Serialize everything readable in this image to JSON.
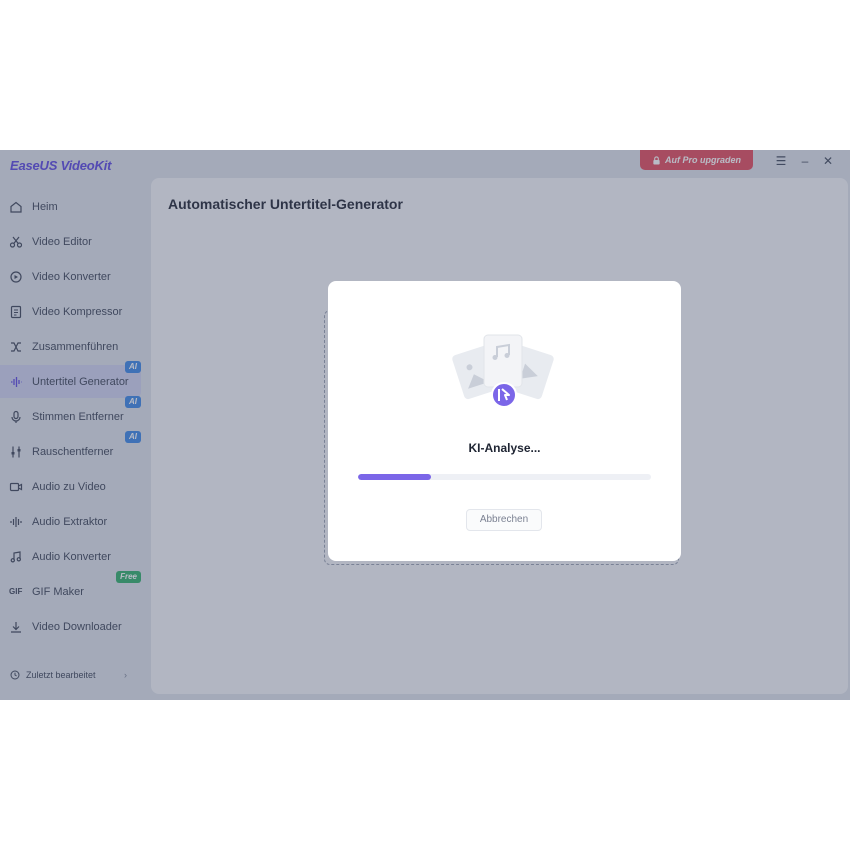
{
  "app": {
    "logo": "EaseUS VideoKit",
    "upgrade_label": "Auf Pro upgraden",
    "window_controls": [
      "menu-icon",
      "minimize-icon",
      "close-icon"
    ]
  },
  "sidebar": {
    "items": [
      {
        "label": "Heim",
        "icon": "home-icon",
        "active": false
      },
      {
        "label": "Video Editor",
        "icon": "scissors-icon",
        "active": false
      },
      {
        "label": "Video Konverter",
        "icon": "convert-icon",
        "active": false
      },
      {
        "label": "Video Kompressor",
        "icon": "compress-icon",
        "active": false
      },
      {
        "label": "Zusammenführen",
        "icon": "merge-icon",
        "active": false
      },
      {
        "label": "Untertitel Generator",
        "icon": "waveform-icon",
        "active": true,
        "badge": "AI"
      },
      {
        "label": "Stimmen Entferner",
        "icon": "microphone-icon",
        "active": false,
        "badge": "AI"
      },
      {
        "label": "Rauschentferner",
        "icon": "sliders-icon",
        "active": false,
        "badge": "AI"
      },
      {
        "label": "Audio zu Video",
        "icon": "video-camera-icon",
        "active": false
      },
      {
        "label": "Audio Extraktor",
        "icon": "audio-wave-icon",
        "active": false
      },
      {
        "label": "Audio Konverter",
        "icon": "music-note-icon",
        "active": false
      },
      {
        "label": "GIF Maker",
        "icon": "gif-icon",
        "active": false,
        "badge": "Free"
      },
      {
        "label": "Video Downloader",
        "icon": "download-icon",
        "active": false
      }
    ],
    "recent_label": "Zuletzt bearbeitet"
  },
  "main": {
    "title": "Automatischer Untertitel-Generator"
  },
  "dialog": {
    "status": "KI-Analyse...",
    "progress": 0.25,
    "cancel_label": "Abbrechen"
  },
  "colors": {
    "accent": "#7b66e8",
    "logo": "#5b47e0",
    "upgrade": "#e34b5c",
    "ai_badge": "#3a86e6",
    "free_badge": "#2fae6a"
  }
}
